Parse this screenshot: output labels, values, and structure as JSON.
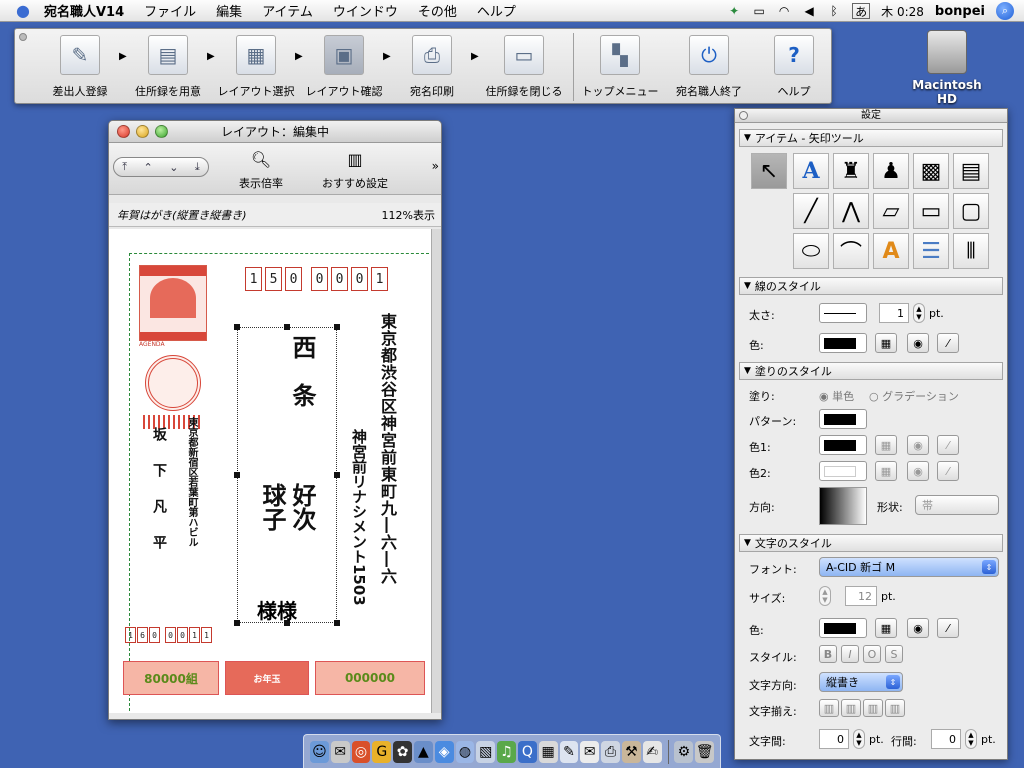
{
  "menubar": {
    "app_name": "宛名職人V14",
    "items": [
      "ファイル",
      "編集",
      "アイテム",
      "ウインドウ",
      "その他",
      "ヘルプ"
    ],
    "status": {
      "ime": "あ",
      "clock": "木 0:28",
      "user": "bonpei"
    }
  },
  "toolbar": {
    "buttons": [
      {
        "label": "差出人登録",
        "icon": "pen-card-icon"
      },
      {
        "label": "住所録を用意",
        "icon": "folder-cards-icon"
      },
      {
        "label": "レイアウト選択",
        "icon": "postcard-layout-icon"
      },
      {
        "label": "レイアウト確認",
        "icon": "screen-preview-icon"
      },
      {
        "label": "宛名印刷",
        "icon": "printer-icon"
      },
      {
        "label": "住所録を閉じる",
        "icon": "folder-close-icon"
      },
      {
        "label": "トップメニュー",
        "icon": "grid-menu-icon"
      },
      {
        "label": "宛名職人終了",
        "icon": "power-icon"
      },
      {
        "label": "ヘルプ",
        "icon": "help-icon"
      }
    ]
  },
  "desktop": {
    "hd_label": "Macintosh HD"
  },
  "layout_window": {
    "title": "レイアウト：編集中",
    "zoom_label": "表示倍率",
    "recommend_label": "おすすめ設定",
    "doc_type": "年賀はがき(縦置き縦書き)",
    "zoom_value": "112%表示",
    "postcard": {
      "recipient_zip": [
        "1",
        "5",
        "0",
        "0",
        "0",
        "0",
        "1"
      ],
      "recipient_address": "東京都渋谷区神宮前東町九―六―六",
      "recipient_building": "神宮前リナシメント1503",
      "recipient_name_1": "西　条",
      "recipient_given_1": "好次",
      "recipient_given_2": "球子",
      "honorific": "様様",
      "sender_address": "東京都新宿区若葉町第ハビル",
      "sender_building": "若葉町",
      "sender_name": "坂　下　凡　平",
      "sender_zip": [
        "1",
        "6",
        "0",
        "0",
        "0",
        "1",
        "1"
      ],
      "lottery_1": "80000組",
      "lottery_2": "お年玉",
      "lottery_3": "000000",
      "stamp_label": "AGENDA"
    }
  },
  "settings": {
    "title": "設定",
    "item_section": "アイテム - 矢印ツール",
    "line_section": "線のスタイル",
    "thickness_label": "太さ:",
    "thickness_value": "1",
    "unit_pt": "pt.",
    "color_label": "色:",
    "fill_section": "塗りのスタイル",
    "fill_label": "塗り:",
    "fill_single": "単色",
    "fill_gradient": "グラデーション",
    "pattern_label": "パターン:",
    "color1_label": "色1:",
    "color2_label": "色2:",
    "direction_label": "方向:",
    "shape_label": "形状:",
    "shape_value": "帯",
    "text_section": "文字のスタイル",
    "font_label": "フォント:",
    "font_value": "A-CID 新ゴ M",
    "size_label": "サイズ:",
    "size_value": "12",
    "text_color_label": "色:",
    "style_label": "スタイル:",
    "text_dir_label": "文字方向:",
    "text_dir_value": "縦書き",
    "align_label": "文字揃え:",
    "spacing_label": "文字間:",
    "spacing_value": "0",
    "line_spacing_label": "行間:",
    "line_spacing_value": "0"
  },
  "colors": {
    "desktop": "#3f63b3",
    "accent_red": "#c43a2e",
    "guide_green": "#2a8a3a"
  }
}
